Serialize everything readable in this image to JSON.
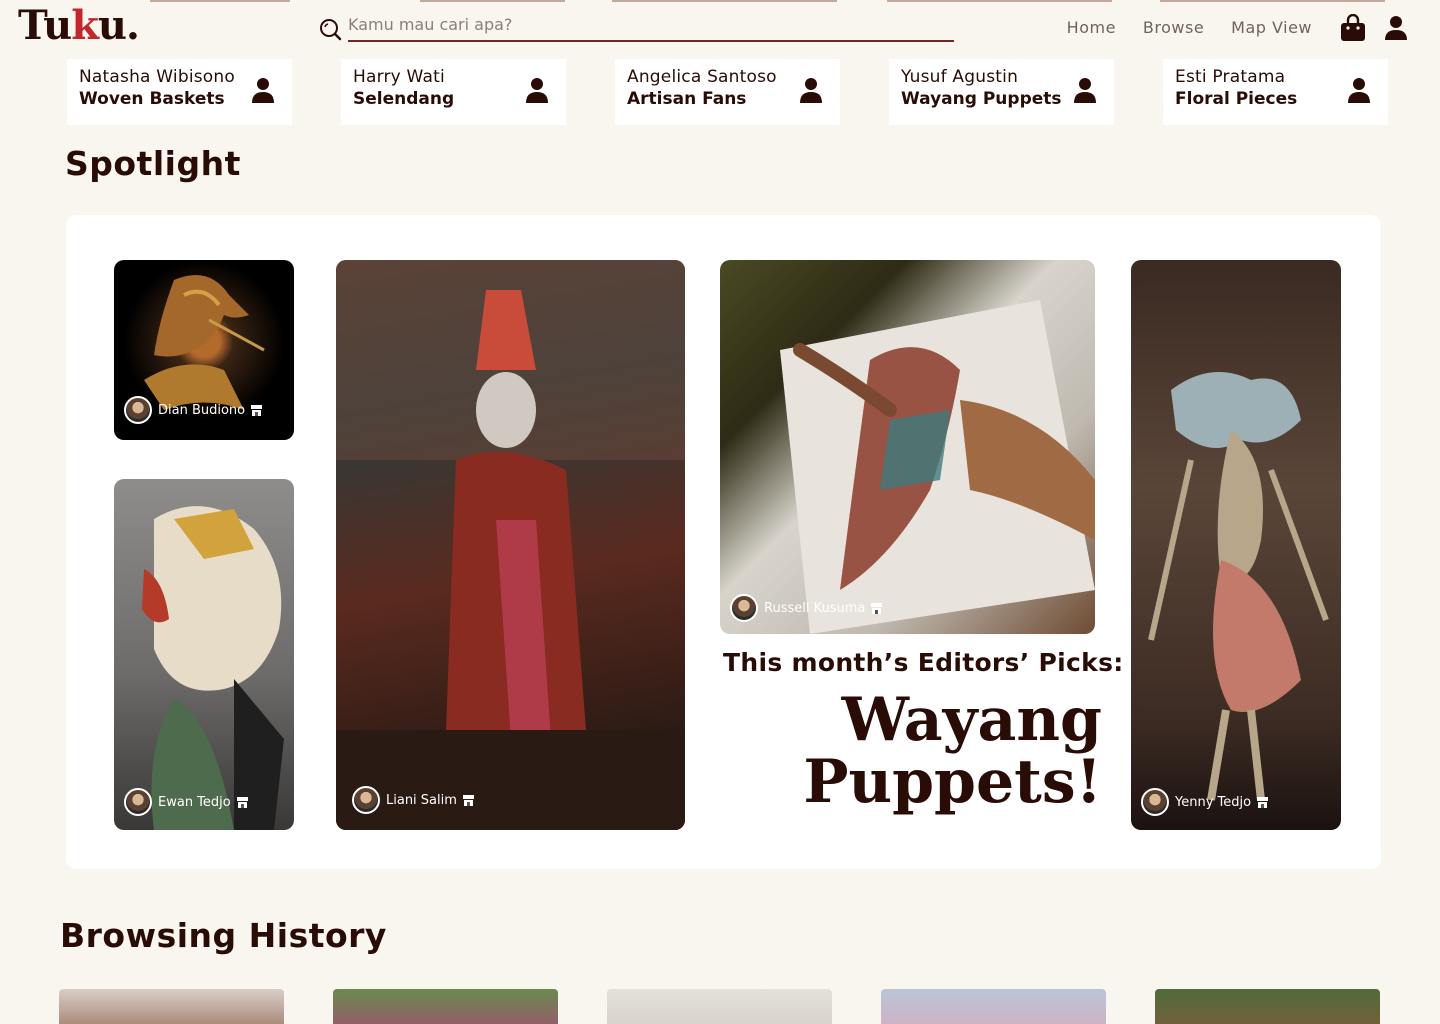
{
  "header": {
    "logo": {
      "prefix": "Tu",
      "accent": "k",
      "suffix": "u."
    },
    "search": {
      "placeholder": "Kamu mau cari apa?",
      "value": ""
    },
    "nav": [
      "Home",
      "Browse",
      "Map View"
    ]
  },
  "artisans": [
    {
      "name": "Natasha Wibisono",
      "craft": "Woven Baskets"
    },
    {
      "name": "Harry Wati",
      "craft": "Selendang"
    },
    {
      "name": "Angelica Santoso",
      "craft": "Artisan Fans"
    },
    {
      "name": "Yusuf Agustin",
      "craft": "Wayang Puppets"
    },
    {
      "name": "Esti Pratama",
      "craft": "Floral Pieces"
    }
  ],
  "spotlight": {
    "title": "Spotlight",
    "tiles": [
      {
        "credit": "Dian Budiono"
      },
      {
        "credit": "Ewan Tedjo"
      },
      {
        "credit": "Liani Salim"
      },
      {
        "credit": "Russell Kusuma"
      },
      {
        "credit": "Yenny Tedjo"
      }
    ],
    "caption": "This month’s Editors’ Picks:",
    "headline_line1": "Wayang",
    "headline_line2": "Puppets!"
  },
  "history": {
    "title": "Browsing History"
  },
  "colors": {
    "background": "#f9f6ef",
    "text": "#2a0c06",
    "accent": "#c2272d"
  }
}
